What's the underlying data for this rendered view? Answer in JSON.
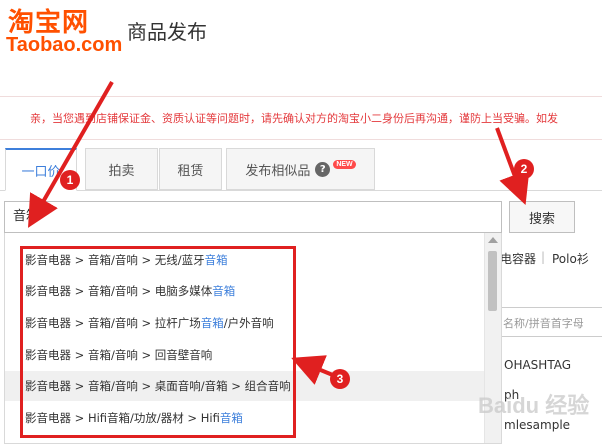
{
  "header": {
    "logo_cn": "淘宝网",
    "logo_en": "Taobao.com",
    "title": "商品发布"
  },
  "notice": {
    "text": "亲，当您遇到店铺保证金、资质认证等问题时，请先确认对方的淘宝小二身份后再沟通，谨防上当受骗。如发"
  },
  "tabs": [
    {
      "label": "一口价",
      "active": true
    },
    {
      "label": "拍卖",
      "active": false
    },
    {
      "label": "租赁",
      "active": false
    },
    {
      "label": "发布相似品",
      "active": false,
      "help_icon": "?",
      "badge": "NEW"
    }
  ],
  "search": {
    "value": "音箱",
    "button_label": "搜索"
  },
  "dropdown": {
    "items": [
      {
        "path": "影音电器 > 音箱/音响 > 无线/蓝牙",
        "highlight": "音箱",
        "suffix": ""
      },
      {
        "path": "影音电器 > 音箱/音响 > 电脑多媒体",
        "highlight": "音箱",
        "suffix": ""
      },
      {
        "path": "影音电器 > 音箱/音响 > 拉杆广场",
        "highlight": "音箱",
        "suffix": "/户外音响"
      },
      {
        "path": "影音电器 > 音箱/音响 > 回音壁音响",
        "highlight": "",
        "suffix": ""
      },
      {
        "path": "影音电器 > 音箱/音响 > 桌面音响/音箱 > 组合音响",
        "highlight": "",
        "suffix": ""
      },
      {
        "path": "影音电器 > Hifi音箱/功放/器材 > Hifi",
        "highlight": "音箱",
        "suffix": ""
      }
    ]
  },
  "background_right": {
    "tags": [
      "电容器",
      "|",
      "Polo衫"
    ],
    "input_placeholder": "名称/拼音首字母",
    "list": [
      "OHASHTAG",
      "ph",
      "mlesample"
    ]
  },
  "annotations": {
    "badge_1": "1",
    "badge_2": "2",
    "badge_3": "3",
    "color": "#e02020"
  },
  "watermark": "Baidu 经验"
}
